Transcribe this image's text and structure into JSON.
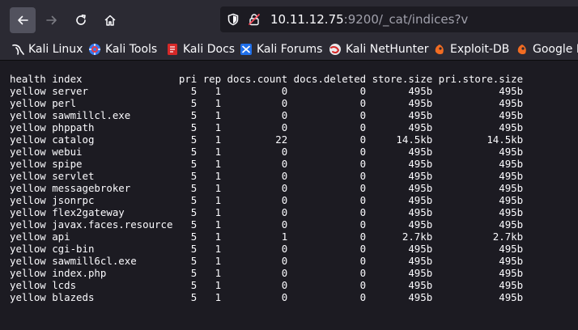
{
  "browser": {
    "url_host": "10.11.12.75",
    "url_rest": ":9200/_cat/indices?v"
  },
  "bookmarks": [
    {
      "label": "Kali Linux",
      "icon": "kali-dragon-icon"
    },
    {
      "label": "Kali Tools",
      "icon": "kali-tools-icon"
    },
    {
      "label": "Kali Docs",
      "icon": "kali-docs-icon"
    },
    {
      "label": "Kali Forums",
      "icon": "kali-forums-icon"
    },
    {
      "label": "Kali NetHunter",
      "icon": "kali-nethunter-icon"
    },
    {
      "label": "Exploit-DB",
      "icon": "exploit-db-icon"
    },
    {
      "label": "Google Hacking DB",
      "icon": "google-hacking-db-icon"
    }
  ],
  "cat_indices": {
    "columns": [
      "health",
      "index",
      "pri",
      "rep",
      "docs.count",
      "docs.deleted",
      "store.size",
      "pri.store.size"
    ],
    "rows": [
      [
        "yellow",
        "server",
        "5",
        "1",
        "0",
        "0",
        "495b",
        "495b"
      ],
      [
        "yellow",
        "perl",
        "5",
        "1",
        "0",
        "0",
        "495b",
        "495b"
      ],
      [
        "yellow",
        "sawmillcl.exe",
        "5",
        "1",
        "0",
        "0",
        "495b",
        "495b"
      ],
      [
        "yellow",
        "phppath",
        "5",
        "1",
        "0",
        "0",
        "495b",
        "495b"
      ],
      [
        "yellow",
        "catalog",
        "5",
        "1",
        "22",
        "0",
        "14.5kb",
        "14.5kb"
      ],
      [
        "yellow",
        "webui",
        "5",
        "1",
        "0",
        "0",
        "495b",
        "495b"
      ],
      [
        "yellow",
        "spipe",
        "5",
        "1",
        "0",
        "0",
        "495b",
        "495b"
      ],
      [
        "yellow",
        "servlet",
        "5",
        "1",
        "0",
        "0",
        "495b",
        "495b"
      ],
      [
        "yellow",
        "messagebroker",
        "5",
        "1",
        "0",
        "0",
        "495b",
        "495b"
      ],
      [
        "yellow",
        "jsonrpc",
        "5",
        "1",
        "0",
        "0",
        "495b",
        "495b"
      ],
      [
        "yellow",
        "flex2gateway",
        "5",
        "1",
        "0",
        "0",
        "495b",
        "495b"
      ],
      [
        "yellow",
        "javax.faces.resource",
        "5",
        "1",
        "0",
        "0",
        "495b",
        "495b"
      ],
      [
        "yellow",
        "api",
        "5",
        "1",
        "1",
        "0",
        "2.7kb",
        "2.7kb"
      ],
      [
        "yellow",
        "cgi-bin",
        "5",
        "1",
        "0",
        "0",
        "495b",
        "495b"
      ],
      [
        "yellow",
        "sawmill6cl.exe",
        "5",
        "1",
        "0",
        "0",
        "495b",
        "495b"
      ],
      [
        "yellow",
        "index.php",
        "5",
        "1",
        "0",
        "0",
        "495b",
        "495b"
      ],
      [
        "yellow",
        "lcds",
        "5",
        "1",
        "0",
        "0",
        "495b",
        "495b"
      ],
      [
        "yellow",
        "blazeds",
        "5",
        "1",
        "0",
        "0",
        "495b",
        "495b"
      ]
    ]
  }
}
